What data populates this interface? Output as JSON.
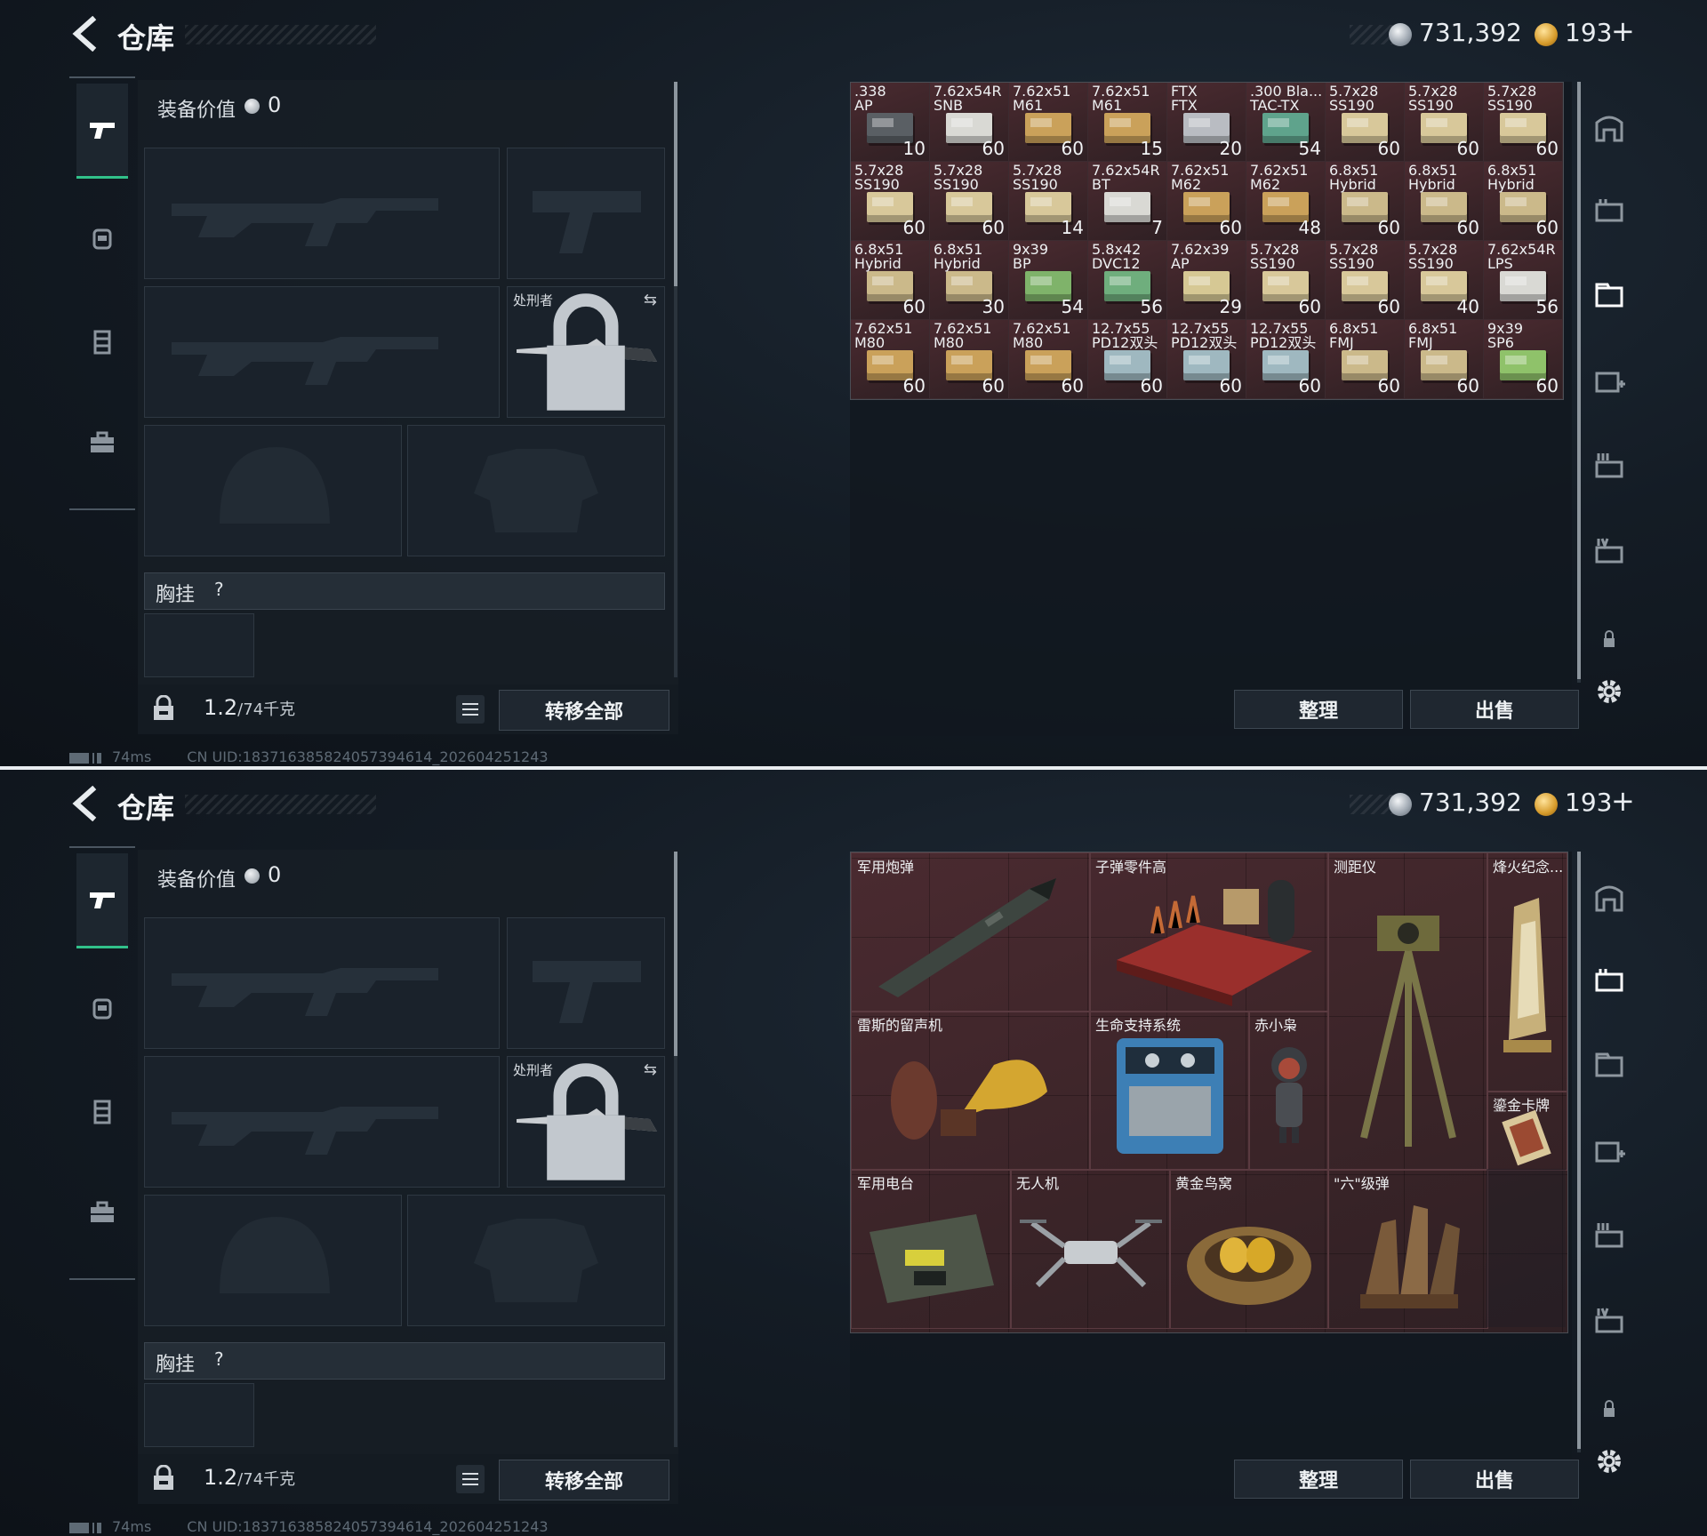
{
  "header": {
    "title": "仓库",
    "currency_silver": "731,392",
    "currency_gold": "193",
    "plus": "+"
  },
  "equipment": {
    "value_label": "装备价值",
    "value": "0",
    "knife_name": "处刑者",
    "chest_label": "胸挂",
    "chest_help": "?",
    "weight_value": "1.2",
    "weight_max": "/74千克",
    "transfer_all": "转移全部"
  },
  "status": {
    "ping": "74ms",
    "uid": "CN UID:18371638582405739461­4_202604251243"
  },
  "stash": {
    "organize": "整理",
    "sell": "出售"
  },
  "ammo": [
    {
      "name": ".338\nAP",
      "qty": "10",
      "color": "#5a5f64"
    },
    {
      "name": "7.62x54R\nSNB",
      "qty": "60",
      "color": "#d9d9d4"
    },
    {
      "name": "7.62x51\nM61",
      "qty": "60",
      "color": "#caa15a"
    },
    {
      "name": "7.62x51\nM61",
      "qty": "15",
      "color": "#caa15a"
    },
    {
      "name": "FTX\nFTX",
      "qty": "20",
      "color": "#b9bcc2"
    },
    {
      "name": ".300 Bla...\nTAC-TX",
      "qty": "54",
      "color": "#5fa38c"
    },
    {
      "name": "5.7x28\nSS190",
      "qty": "60",
      "color": "#d8c89a"
    },
    {
      "name": "5.7x28\nSS190",
      "qty": "60",
      "color": "#d8c89a"
    },
    {
      "name": "5.7x28\nSS190",
      "qty": "60",
      "color": "#d8c89a"
    },
    {
      "name": "5.7x28\nSS190",
      "qty": "60",
      "color": "#d8c89a"
    },
    {
      "name": "5.7x28\nSS190",
      "qty": "60",
      "color": "#d8c89a"
    },
    {
      "name": "5.7x28\nSS190",
      "qty": "14",
      "color": "#d8c89a"
    },
    {
      "name": "7.62x54R\nBT",
      "qty": "7",
      "color": "#d9d9d4"
    },
    {
      "name": "7.62x51\nM62",
      "qty": "60",
      "color": "#caa15a"
    },
    {
      "name": "7.62x51\nM62",
      "qty": "48",
      "color": "#caa15a"
    },
    {
      "name": "6.8x51\nHybrid",
      "qty": "60",
      "color": "#cbb98a"
    },
    {
      "name": "6.8x51\nHybrid",
      "qty": "60",
      "color": "#cbb98a"
    },
    {
      "name": "6.8x51\nHybrid",
      "qty": "60",
      "color": "#cbb98a"
    },
    {
      "name": "6.8x51\nHybrid",
      "qty": "60",
      "color": "#cbb98a"
    },
    {
      "name": "6.8x51\nHybrid",
      "qty": "30",
      "color": "#cbb98a"
    },
    {
      "name": "9x39\nBP",
      "qty": "54",
      "color": "#7fb36a"
    },
    {
      "name": "5.8x42\nDVC12",
      "qty": "56",
      "color": "#6fae7d"
    },
    {
      "name": "7.62x39\nAP",
      "qty": "29",
      "color": "#d6c894"
    },
    {
      "name": "5.7x28\nSS190",
      "qty": "60",
      "color": "#d8c89a"
    },
    {
      "name": "5.7x28\nSS190",
      "qty": "60",
      "color": "#d8c89a"
    },
    {
      "name": "5.7x28\nSS190",
      "qty": "40",
      "color": "#d8c89a"
    },
    {
      "name": "7.62x54R\nLPS",
      "qty": "56",
      "color": "#d9d9d4"
    },
    {
      "name": "7.62x51\nM80",
      "qty": "60",
      "color": "#caa15a"
    },
    {
      "name": "7.62x51\nM80",
      "qty": "60",
      "color": "#caa15a"
    },
    {
      "name": "7.62x51\nM80",
      "qty": "60",
      "color": "#caa15a"
    },
    {
      "name": "12.7x55\nPD12双头",
      "qty": "60",
      "color": "#9fb8c0"
    },
    {
      "name": "12.7x55\nPD12双头",
      "qty": "60",
      "color": "#9fb8c0"
    },
    {
      "name": "12.7x55\nPD12双头",
      "qty": "60",
      "color": "#9fb8c0"
    },
    {
      "name": "6.8x51\nFMJ",
      "qty": "60",
      "color": "#cbb98a"
    },
    {
      "name": "6.8x51\nFMJ",
      "qty": "60",
      "color": "#cbb98a"
    },
    {
      "name": "9x39\nSP6",
      "qty": "60",
      "color": "#8fc26a"
    }
  ],
  "collectibles": {
    "shell": "军用炮弹",
    "parts": "子弹零件高",
    "rangefinder": "测距仪",
    "beacon": "烽火纪念...",
    "gramophone": "雷斯的留声机",
    "lifesupport": "生命支持系统",
    "owl": "赤小枭",
    "goldcard": "鎏金卡牌",
    "radio": "军用电台",
    "drone": "无人机",
    "nest": "黄金鸟窝",
    "bullet": "\"六\"级弹"
  }
}
